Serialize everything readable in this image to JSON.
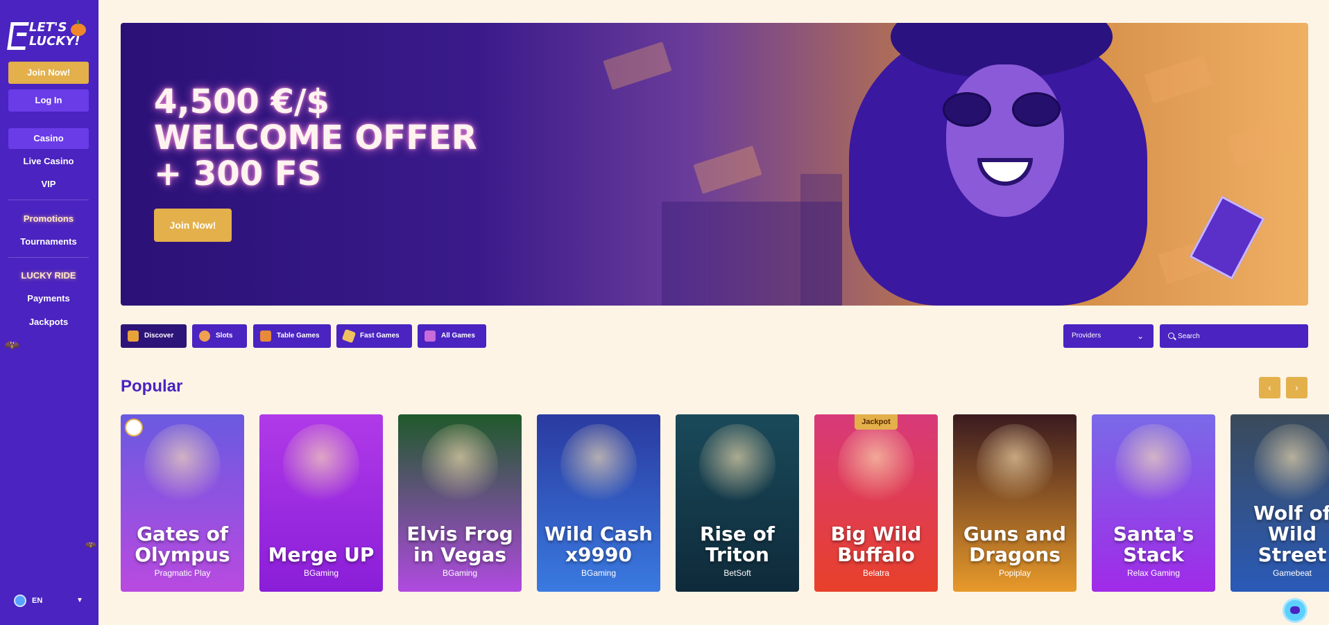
{
  "brand": {
    "logo_text": "LET'S LUCKY!"
  },
  "sidebar": {
    "join_label": "Join Now!",
    "login_label": "Log In",
    "nav": [
      {
        "label": "Casino"
      },
      {
        "label": "Live Casino"
      },
      {
        "label": "VIP"
      },
      {
        "label": "Promotions"
      },
      {
        "label": "Tournaments"
      },
      {
        "label": "LUCKY RIDE"
      },
      {
        "label": "Payments"
      },
      {
        "label": "Jackpots"
      }
    ],
    "language": "EN"
  },
  "hero": {
    "line1": "4,500 €/$",
    "line2": "WELCOME OFFER",
    "line3": "+ 300 FS",
    "cta": "Join Now!"
  },
  "filters": [
    {
      "label": "Discover",
      "icon": "discover-icon"
    },
    {
      "label": "Slots",
      "icon": "slots-icon"
    },
    {
      "label": "Table Games",
      "icon": "table-games-icon"
    },
    {
      "label": "Fast Games",
      "icon": "fast-games-icon"
    },
    {
      "label": "All Games",
      "icon": "all-games-icon"
    }
  ],
  "providers_label": "Providers",
  "search": {
    "placeholder": "Search"
  },
  "section": {
    "title": "Popular"
  },
  "games": [
    {
      "title": "Gates of Olympus",
      "provider": "Pragmatic Play",
      "color_top": "#6a5ae0",
      "color_bottom": "#b94ae0"
    },
    {
      "title": "Merge UP",
      "provider": "BGaming",
      "color_top": "#b03ae8",
      "color_bottom": "#8a1ed8"
    },
    {
      "title": "Elvis Frog in Vegas",
      "provider": "BGaming",
      "color_top": "#1f5a2a",
      "color_bottom": "#b04ae0"
    },
    {
      "title": "Wild Cash x9990",
      "provider": "BGaming",
      "color_top": "#2a3aa0",
      "color_bottom": "#3a7ae0"
    },
    {
      "title": "Rise of Triton",
      "provider": "BetSoft",
      "color_top": "#1a4a5a",
      "color_bottom": "#0e2a3a"
    },
    {
      "title": "Big Wild Buffalo",
      "provider": "Belatra",
      "badge": "Jackpot",
      "color_top": "#d83a7a",
      "color_bottom": "#e8402a"
    },
    {
      "title": "Guns and Dragons",
      "provider": "Popiplay",
      "color_top": "#3a1a20",
      "color_bottom": "#e89a2a"
    },
    {
      "title": "Santa's Stack",
      "provider": "Relax Gaming",
      "color_top": "#7a6ae8",
      "color_bottom": "#a02ae8"
    },
    {
      "title": "Wolf of Wild Street",
      "provider": "Gamebeat",
      "color_top": "#3a4a5a",
      "color_bottom": "#2a5ab8"
    }
  ]
}
